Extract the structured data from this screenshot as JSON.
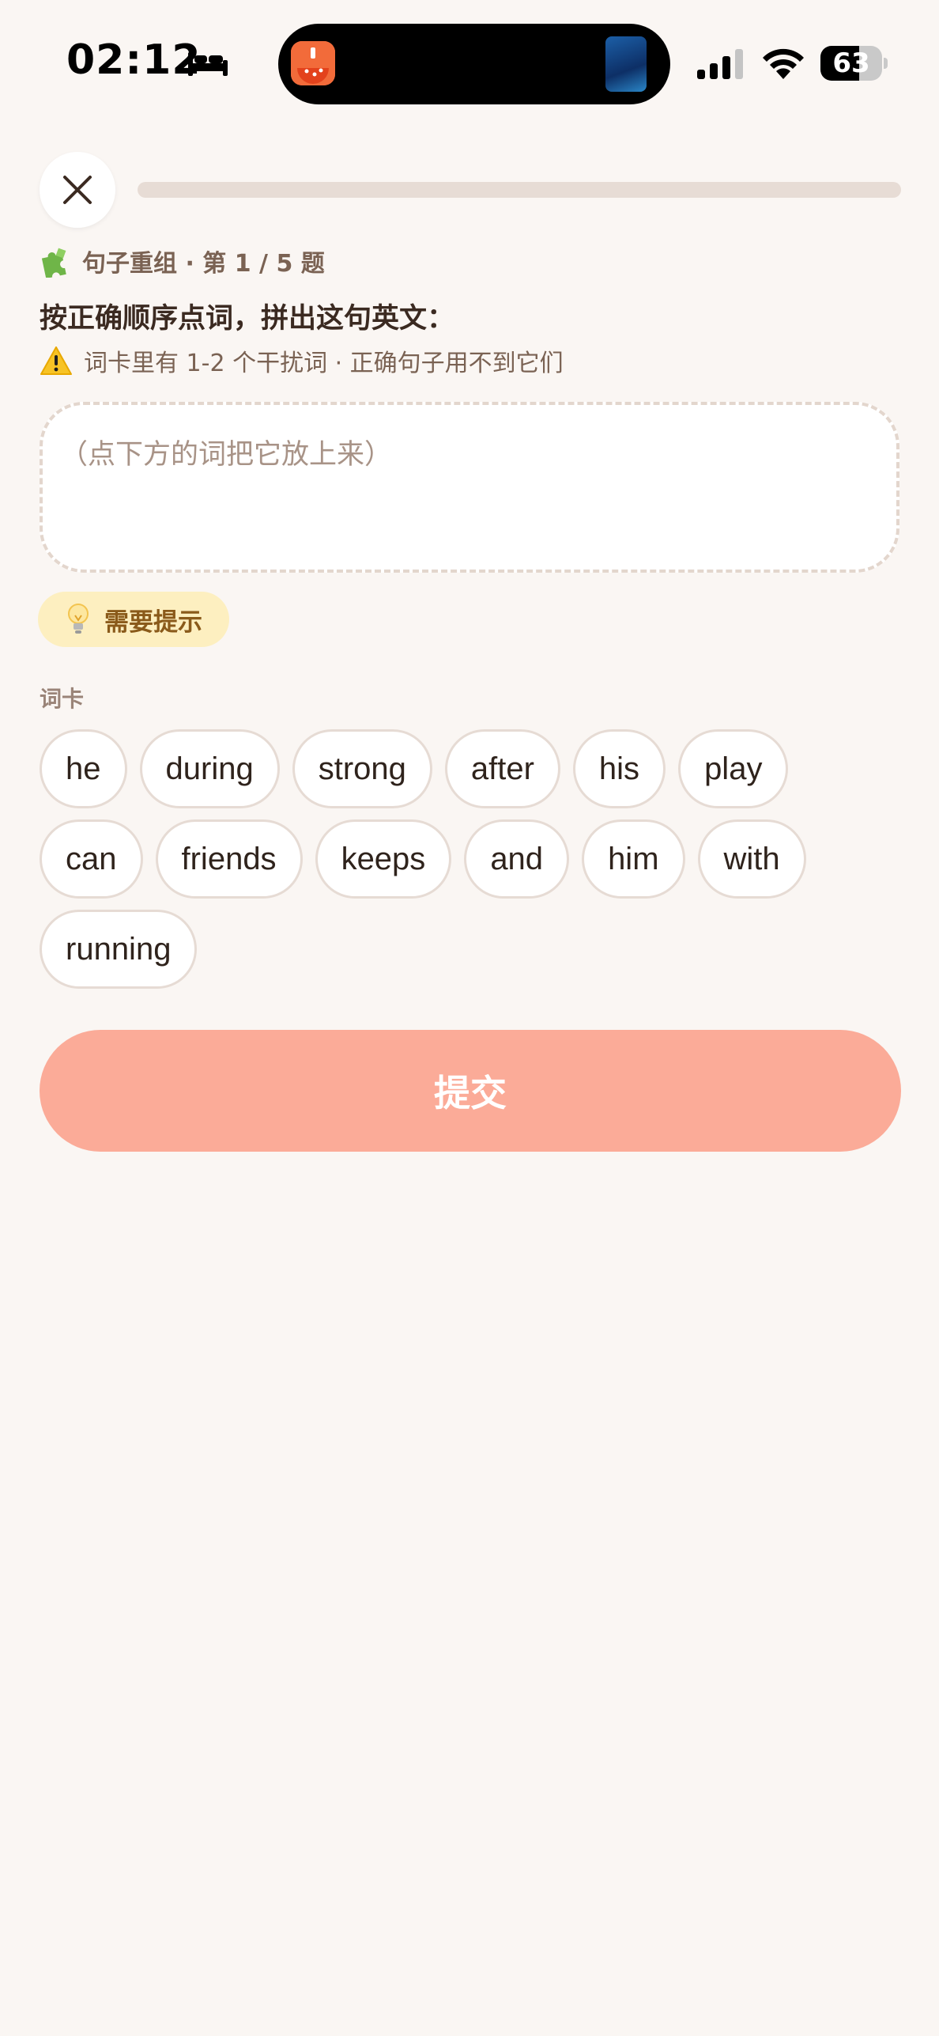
{
  "status_bar": {
    "time": "02:12",
    "battery_percent": "63",
    "battery_level": 0.63
  },
  "quiz": {
    "progress_fraction": 0,
    "section_label": "句子重组 · 第 1 / 5 题",
    "instruction": "按正确顺序点词，拼出这句英文：",
    "warning": "词卡里有 1-2 个干扰词 · 正确句子用不到它们",
    "answer_placeholder": "（点下方的词把它放上来）",
    "hint_label": "需要提示",
    "bank_label": "词卡",
    "words": {
      "w0": "he",
      "w1": "during",
      "w2": "strong",
      "w3": "after",
      "w4": "his",
      "w5": "play",
      "w6": "can",
      "w7": "friends",
      "w8": "keeps",
      "w9": "and",
      "w10": "him",
      "w11": "with",
      "w12": "running"
    },
    "submit_label": "提交"
  },
  "icons": {
    "close": "close-icon",
    "puzzle": "puzzle-icon",
    "warning": "warning-icon",
    "bulb": "lightbulb-icon"
  },
  "colors": {
    "background": "#faf6f3",
    "accent": "#fbab98",
    "hint_bg": "#fdefc0",
    "hint_text": "#8a5a1a"
  }
}
